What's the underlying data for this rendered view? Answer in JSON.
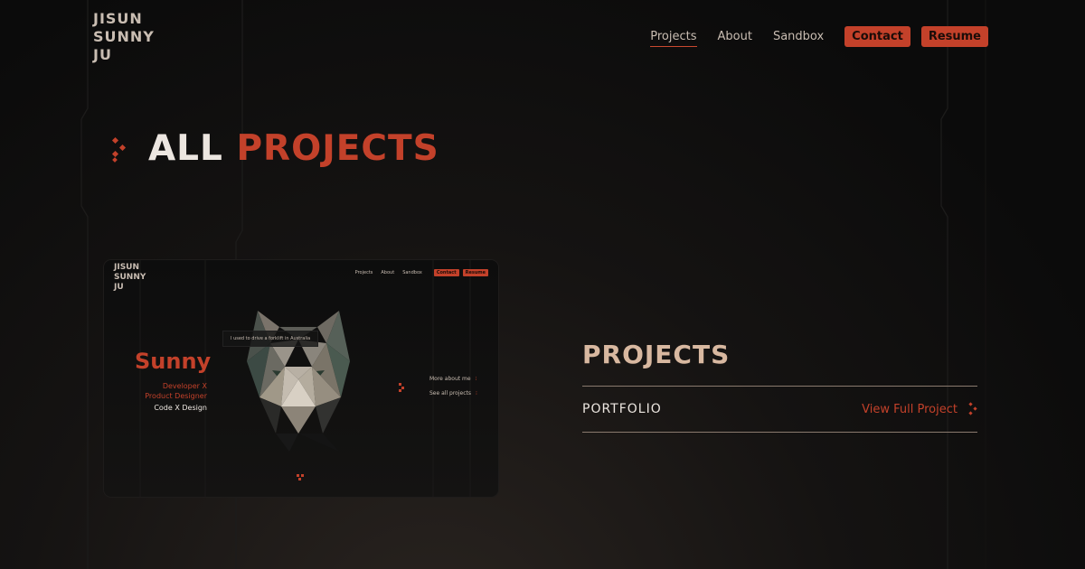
{
  "header": {
    "logo": "JISUN\nSUNNY\nJU",
    "nav": {
      "projects": "Projects",
      "about": "About",
      "sandbox": "Sandbox",
      "contact": "Contact",
      "resume": "Resume"
    }
  },
  "hero": {
    "title_white": "ALL",
    "title_accent": "PROJECTS"
  },
  "preview": {
    "logo": "JISUN\nSUNNY\nJU",
    "nav": [
      "Projects",
      "About",
      "Sandbox",
      "Contact",
      "Resume"
    ],
    "name": "Sunny",
    "role": "Developer X\nProduct Designer",
    "tagline": "Code X Design",
    "bubble": "I used to drive a forklift in Australia",
    "link_more": "More about me",
    "link_all": "See all projects"
  },
  "projects": {
    "heading": "PROJECTS",
    "items": [
      {
        "name": "PORTFOLIO",
        "link": "View Full Project"
      }
    ]
  },
  "colors": {
    "accent": "#c3412a",
    "background": "#0b0b0b",
    "heading_tan": "#d8b8a0"
  }
}
